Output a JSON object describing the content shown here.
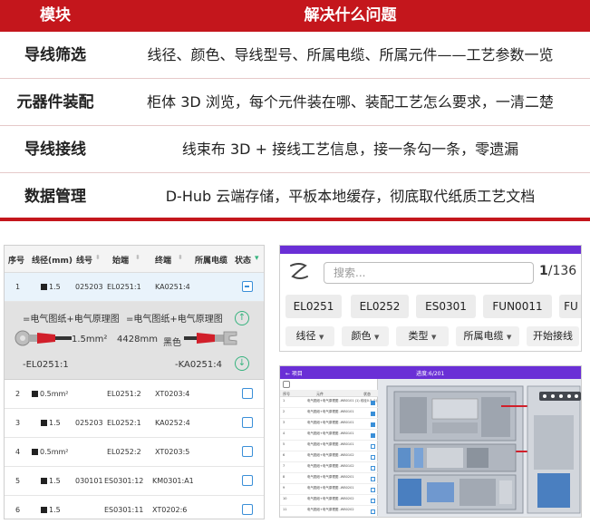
{
  "feature_table": {
    "header": {
      "col1": "模块",
      "col2": "解决什么问题"
    },
    "rows": [
      {
        "name": "导线筛选",
        "desc": "线径、颜色、导线型号、所属电缆、所属元件——工艺参数一览"
      },
      {
        "name": "元器件装配",
        "desc": "柜体 3D 浏览，每个元件装在哪、装配工艺怎么要求，一清二楚"
      },
      {
        "name": "导线接线",
        "desc": "线束布 3D + 接线工艺信息，接一条勾一条，零遗漏"
      },
      {
        "name": "数据管理",
        "desc": "D-Hub 云端存储，平板本地缓存，彻底取代纸质工艺文档"
      }
    ],
    "colors": {
      "header_bg": "#c4161c",
      "header_text": "#ffffff"
    }
  },
  "wire_list": {
    "columns": [
      "序号",
      "线径(mm)",
      "线号",
      "始端",
      "终端",
      "所属电缆",
      "状态"
    ],
    "sort_icon": "sort-arrows-icon",
    "rows": [
      {
        "no": "1",
        "size": "1.5",
        "wire": "025203",
        "from": "EL0251:1",
        "to": "KA0251:4",
        "state": "minus"
      },
      {
        "no": "2",
        "size": "0.5mm²",
        "wire": "",
        "from": "EL0251:2",
        "to": "XT0203:4",
        "state": ""
      },
      {
        "no": "3",
        "size": "1.5",
        "wire": "025203",
        "from": "EL0252:1",
        "to": "KA0252:4",
        "state": ""
      },
      {
        "no": "4",
        "size": "0.5mm²",
        "wire": "",
        "from": "EL0252:2",
        "to": "XT0203:5",
        "state": ""
      },
      {
        "no": "5",
        "size": "1.5",
        "wire": "030101",
        "from": "ES0301:12",
        "to": "KM0301:A1",
        "state": ""
      },
      {
        "no": "6",
        "size": "1.5",
        "wire": "",
        "from": "ES0301:11",
        "to": "XT0202:6",
        "state": ""
      }
    ],
    "detail": {
      "left_ref": "=电气图纸+电气原理图",
      "right_ref": "=电气图纸+电气原理图",
      "cross_section": "1.5mm²",
      "length": "4428mm",
      "color": "黑色",
      "from_label": "-EL0251:1",
      "to_label": "-KA0251:4",
      "wire_color": "#d11f2a"
    },
    "colors": {
      "accent": "#3a8fd8",
      "detail_bg": "#e2e2e2",
      "nav_circle": "#36b37e"
    }
  },
  "search_panel": {
    "placeholder": "搜索...",
    "page_current": "1",
    "page_total": "/136",
    "chips": [
      "EL0251",
      "EL0252",
      "ES0301",
      "FUN0011",
      "FU"
    ],
    "filters": [
      "线径",
      "颜色",
      "类型",
      "所属电缆"
    ],
    "filter_dropdown_icon": "caret-down-icon",
    "start_button": "开始接线",
    "colors": {
      "top_bar": "#6a2fd6"
    }
  },
  "three_d_view": {
    "back_label": "← 项目",
    "progress": "进度:6/201",
    "list_columns": [
      "序号",
      "元件",
      "状态"
    ],
    "items": [
      {
        "no": "1",
        "label": "电气图纸+电气原理图 -WB0101 (1) 线径0.5 (1)",
        "checked": true
      },
      {
        "no": "2",
        "label": "电气图纸+电气原理图 -WB0101",
        "checked": true
      },
      {
        "no": "3",
        "label": "电气图纸+电气原理图 -WB0101",
        "checked": true
      },
      {
        "no": "4",
        "label": "电气图纸+电气原理图 -WB0101",
        "checked": true
      },
      {
        "no": "5",
        "label": "电气图纸+电气原理图 -WB0101",
        "checked": false
      },
      {
        "no": "6",
        "label": "电气图纸+电气原理图 -WB0102",
        "checked": false
      },
      {
        "no": "7",
        "label": "电气图纸+电气原理图 -WB0102",
        "checked": false
      },
      {
        "no": "8",
        "label": "电气图纸+电气原理图 -WB0201",
        "checked": false
      },
      {
        "no": "9",
        "label": "电气图纸+电气原理图 -WB0201",
        "checked": false
      },
      {
        "no": "10",
        "label": "电气图纸+电气原理图 -WB0202",
        "checked": false
      },
      {
        "no": "11",
        "label": "电气图纸+电气原理图 -WB0202",
        "checked": false
      }
    ]
  }
}
